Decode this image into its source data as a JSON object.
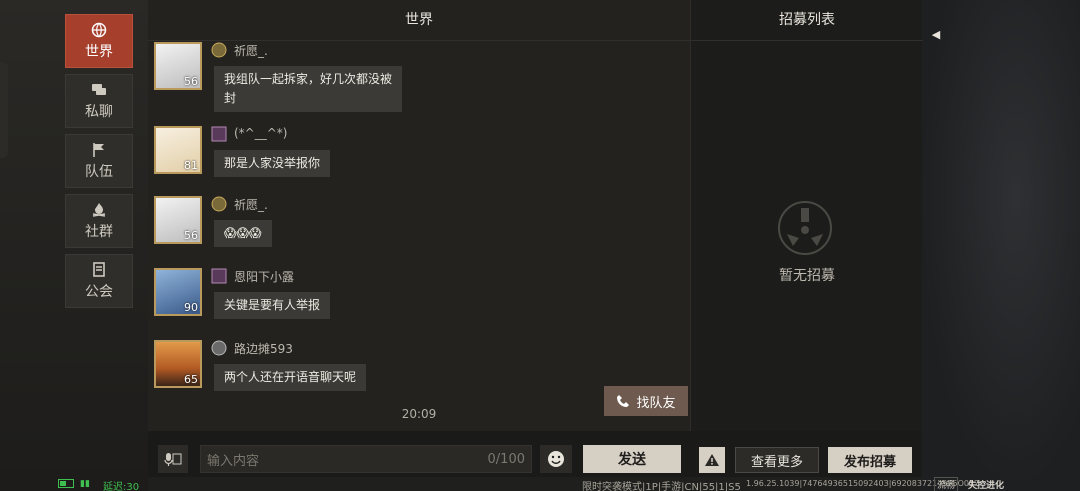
{
  "nav": {
    "items": [
      {
        "label": "世界",
        "active": true,
        "icon": "globe-icon"
      },
      {
        "label": "私聊",
        "active": false,
        "icon": "chat-bubbles-icon"
      },
      {
        "label": "队伍",
        "active": false,
        "icon": "flag-icon"
      },
      {
        "label": "社群",
        "active": false,
        "icon": "campfire-icon"
      },
      {
        "label": "公会",
        "active": false,
        "icon": "banner-icon"
      }
    ]
  },
  "chat": {
    "title": "世界",
    "messages": [
      {
        "name": "祈愿_.",
        "text_lines": [
          "我组队一起拆家，好几次都没被",
          "封"
        ],
        "level": "56",
        "badge": "IV"
      },
      {
        "name": "(*^__^*)",
        "text_lines": [
          "那是人家没举报你"
        ],
        "level": "81",
        "badge": "I"
      },
      {
        "name": "祈愿_.",
        "text_lines": [
          "😱😱😱"
        ],
        "level": "56",
        "badge": "IV"
      },
      {
        "name": "恩阳下小露",
        "text_lines": [
          "关键是要有人举报"
        ],
        "level": "90",
        "badge": "I"
      },
      {
        "name": "路边摊593",
        "text_lines": [
          "两个人还在开语音聊天呢"
        ],
        "level": "65",
        "badge": "IV"
      }
    ],
    "time": "20:09",
    "find_team_label": "找队友"
  },
  "recruit": {
    "title": "招募列表",
    "empty_text": "暂无招募"
  },
  "bottom": {
    "input_placeholder": "输入内容",
    "char_count": "0/100",
    "send_label": "发送",
    "more_label": "查看更多",
    "publish_label": "发布招募"
  },
  "status": {
    "latency": "延迟:30",
    "mode": "限时突袭模式|1P|手游|CN|55|1|S5",
    "version": "1.96.25.1039|7476493651509240З|6920837214575O017",
    "quality": "流畅",
    "logo": "失控进化"
  },
  "colors": {
    "accent_active": "#a6402d",
    "button_light": "#d6cfc4",
    "status_green": "#3fbf4f"
  }
}
